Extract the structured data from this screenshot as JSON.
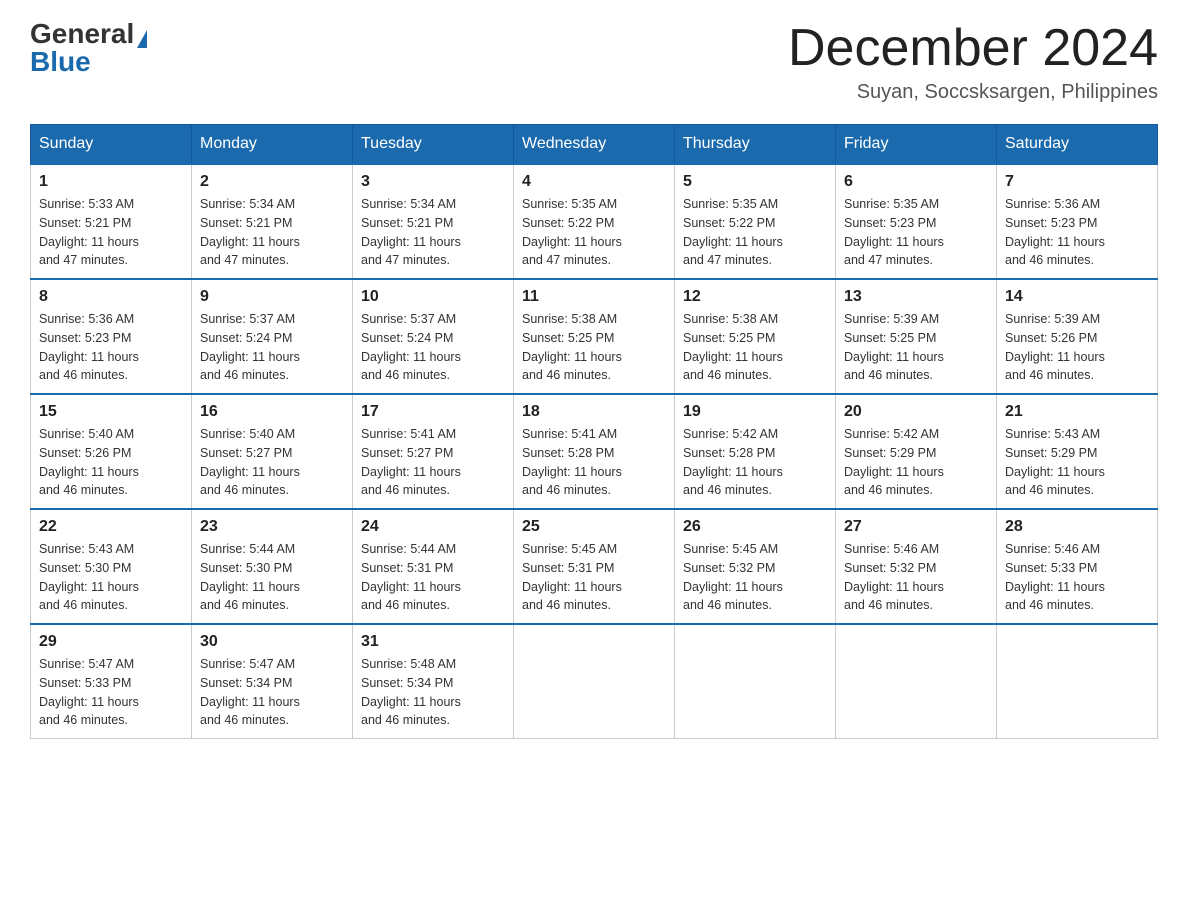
{
  "header": {
    "logo_general": "General",
    "logo_blue": "Blue",
    "month_title": "December 2024",
    "location": "Suyan, Soccsksargen, Philippines"
  },
  "days_of_week": [
    "Sunday",
    "Monday",
    "Tuesday",
    "Wednesday",
    "Thursday",
    "Friday",
    "Saturday"
  ],
  "weeks": [
    [
      {
        "day": "1",
        "sunrise": "5:33 AM",
        "sunset": "5:21 PM",
        "daylight": "11 hours and 47 minutes."
      },
      {
        "day": "2",
        "sunrise": "5:34 AM",
        "sunset": "5:21 PM",
        "daylight": "11 hours and 47 minutes."
      },
      {
        "day": "3",
        "sunrise": "5:34 AM",
        "sunset": "5:21 PM",
        "daylight": "11 hours and 47 minutes."
      },
      {
        "day": "4",
        "sunrise": "5:35 AM",
        "sunset": "5:22 PM",
        "daylight": "11 hours and 47 minutes."
      },
      {
        "day": "5",
        "sunrise": "5:35 AM",
        "sunset": "5:22 PM",
        "daylight": "11 hours and 47 minutes."
      },
      {
        "day": "6",
        "sunrise": "5:35 AM",
        "sunset": "5:23 PM",
        "daylight": "11 hours and 47 minutes."
      },
      {
        "day": "7",
        "sunrise": "5:36 AM",
        "sunset": "5:23 PM",
        "daylight": "11 hours and 46 minutes."
      }
    ],
    [
      {
        "day": "8",
        "sunrise": "5:36 AM",
        "sunset": "5:23 PM",
        "daylight": "11 hours and 46 minutes."
      },
      {
        "day": "9",
        "sunrise": "5:37 AM",
        "sunset": "5:24 PM",
        "daylight": "11 hours and 46 minutes."
      },
      {
        "day": "10",
        "sunrise": "5:37 AM",
        "sunset": "5:24 PM",
        "daylight": "11 hours and 46 minutes."
      },
      {
        "day": "11",
        "sunrise": "5:38 AM",
        "sunset": "5:25 PM",
        "daylight": "11 hours and 46 minutes."
      },
      {
        "day": "12",
        "sunrise": "5:38 AM",
        "sunset": "5:25 PM",
        "daylight": "11 hours and 46 minutes."
      },
      {
        "day": "13",
        "sunrise": "5:39 AM",
        "sunset": "5:25 PM",
        "daylight": "11 hours and 46 minutes."
      },
      {
        "day": "14",
        "sunrise": "5:39 AM",
        "sunset": "5:26 PM",
        "daylight": "11 hours and 46 minutes."
      }
    ],
    [
      {
        "day": "15",
        "sunrise": "5:40 AM",
        "sunset": "5:26 PM",
        "daylight": "11 hours and 46 minutes."
      },
      {
        "day": "16",
        "sunrise": "5:40 AM",
        "sunset": "5:27 PM",
        "daylight": "11 hours and 46 minutes."
      },
      {
        "day": "17",
        "sunrise": "5:41 AM",
        "sunset": "5:27 PM",
        "daylight": "11 hours and 46 minutes."
      },
      {
        "day": "18",
        "sunrise": "5:41 AM",
        "sunset": "5:28 PM",
        "daylight": "11 hours and 46 minutes."
      },
      {
        "day": "19",
        "sunrise": "5:42 AM",
        "sunset": "5:28 PM",
        "daylight": "11 hours and 46 minutes."
      },
      {
        "day": "20",
        "sunrise": "5:42 AM",
        "sunset": "5:29 PM",
        "daylight": "11 hours and 46 minutes."
      },
      {
        "day": "21",
        "sunrise": "5:43 AM",
        "sunset": "5:29 PM",
        "daylight": "11 hours and 46 minutes."
      }
    ],
    [
      {
        "day": "22",
        "sunrise": "5:43 AM",
        "sunset": "5:30 PM",
        "daylight": "11 hours and 46 minutes."
      },
      {
        "day": "23",
        "sunrise": "5:44 AM",
        "sunset": "5:30 PM",
        "daylight": "11 hours and 46 minutes."
      },
      {
        "day": "24",
        "sunrise": "5:44 AM",
        "sunset": "5:31 PM",
        "daylight": "11 hours and 46 minutes."
      },
      {
        "day": "25",
        "sunrise": "5:45 AM",
        "sunset": "5:31 PM",
        "daylight": "11 hours and 46 minutes."
      },
      {
        "day": "26",
        "sunrise": "5:45 AM",
        "sunset": "5:32 PM",
        "daylight": "11 hours and 46 minutes."
      },
      {
        "day": "27",
        "sunrise": "5:46 AM",
        "sunset": "5:32 PM",
        "daylight": "11 hours and 46 minutes."
      },
      {
        "day": "28",
        "sunrise": "5:46 AM",
        "sunset": "5:33 PM",
        "daylight": "11 hours and 46 minutes."
      }
    ],
    [
      {
        "day": "29",
        "sunrise": "5:47 AM",
        "sunset": "5:33 PM",
        "daylight": "11 hours and 46 minutes."
      },
      {
        "day": "30",
        "sunrise": "5:47 AM",
        "sunset": "5:34 PM",
        "daylight": "11 hours and 46 minutes."
      },
      {
        "day": "31",
        "sunrise": "5:48 AM",
        "sunset": "5:34 PM",
        "daylight": "11 hours and 46 minutes."
      },
      null,
      null,
      null,
      null
    ]
  ],
  "labels": {
    "sunrise": "Sunrise:",
    "sunset": "Sunset:",
    "daylight": "Daylight:"
  }
}
